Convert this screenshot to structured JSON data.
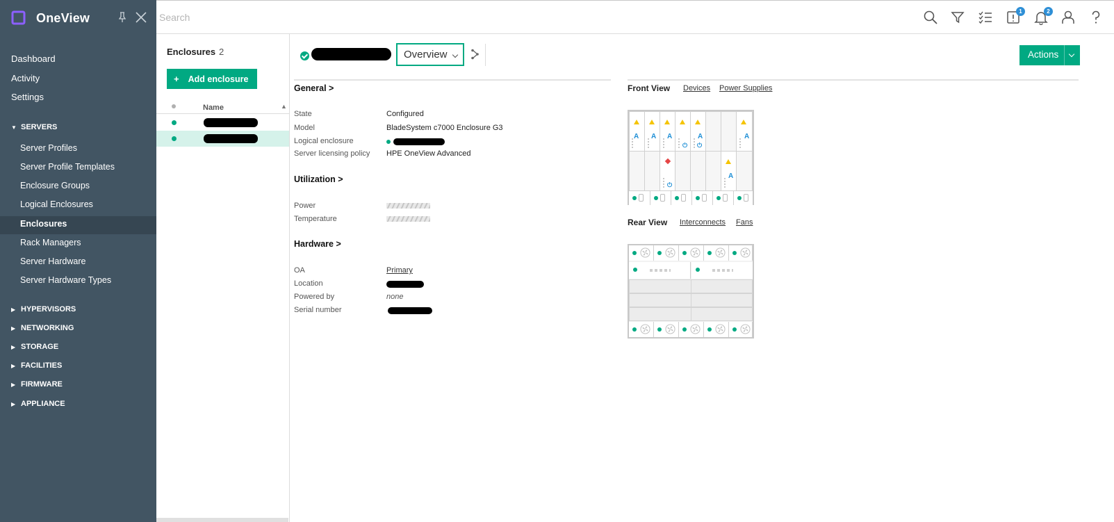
{
  "app": {
    "title": "OneView"
  },
  "sidebar": {
    "top": [
      {
        "label": "Dashboard"
      },
      {
        "label": "Activity"
      },
      {
        "label": "Settings"
      }
    ],
    "servers": {
      "label": "SERVERS",
      "items": [
        {
          "label": "Server Profiles"
        },
        {
          "label": "Server Profile Templates"
        },
        {
          "label": "Enclosure Groups"
        },
        {
          "label": "Logical Enclosures"
        },
        {
          "label": "Enclosures",
          "active": true
        },
        {
          "label": "Rack Managers"
        },
        {
          "label": "Server Hardware"
        },
        {
          "label": "Server Hardware Types"
        }
      ]
    },
    "sections": [
      {
        "label": "HYPERVISORS"
      },
      {
        "label": "NETWORKING"
      },
      {
        "label": "STORAGE"
      },
      {
        "label": "FACILITIES"
      },
      {
        "label": "FIRMWARE"
      },
      {
        "label": "APPLIANCE"
      }
    ]
  },
  "topbar": {
    "search_placeholder": "Search",
    "icons": [
      "search-icon",
      "filter-icon",
      "checklist-icon",
      "alerts-icon",
      "notifications-icon",
      "user-icon",
      "help-icon"
    ],
    "alerts_badge": "1",
    "notifications_badge": "2"
  },
  "list": {
    "title": "Enclosures",
    "count": "2",
    "add_label": "Add enclosure",
    "column_name": "Name",
    "rows": [
      {
        "status": "ok",
        "name": ""
      },
      {
        "status": "ok",
        "name": "",
        "selected": true
      }
    ]
  },
  "detail": {
    "view_select": "Overview",
    "actions_label": "Actions",
    "general": {
      "title": "General >",
      "fields": [
        {
          "key": "State",
          "value": "Configured"
        },
        {
          "key": "Model",
          "value": "BladeSystem c7000 Enclosure G3"
        },
        {
          "key": "Logical enclosure",
          "value": ""
        },
        {
          "key": "Server licensing policy",
          "value": "HPE OneView Advanced"
        }
      ]
    },
    "utilization": {
      "title": "Utilization >",
      "fields": [
        {
          "key": "Power"
        },
        {
          "key": "Temperature"
        }
      ]
    },
    "hardware": {
      "title": "Hardware >",
      "fields": [
        {
          "key": "OA",
          "value": "Primary"
        },
        {
          "key": "Location",
          "value": ""
        },
        {
          "key": "Powered by",
          "value": "none"
        },
        {
          "key": "Serial number",
          "value": ""
        }
      ]
    },
    "front_view": {
      "title": "Front View",
      "links": [
        "Devices",
        "Power Supplies"
      ]
    },
    "rear_view": {
      "title": "Rear View",
      "links": [
        "Interconnects",
        "Fans"
      ]
    }
  },
  "colors": {
    "sidebar_bg": "#425563",
    "accent": "#01a982",
    "selected_row": "#d5f2ea",
    "warning": "#f5c400",
    "info": "#1f8fd6",
    "error": "#e54545"
  }
}
